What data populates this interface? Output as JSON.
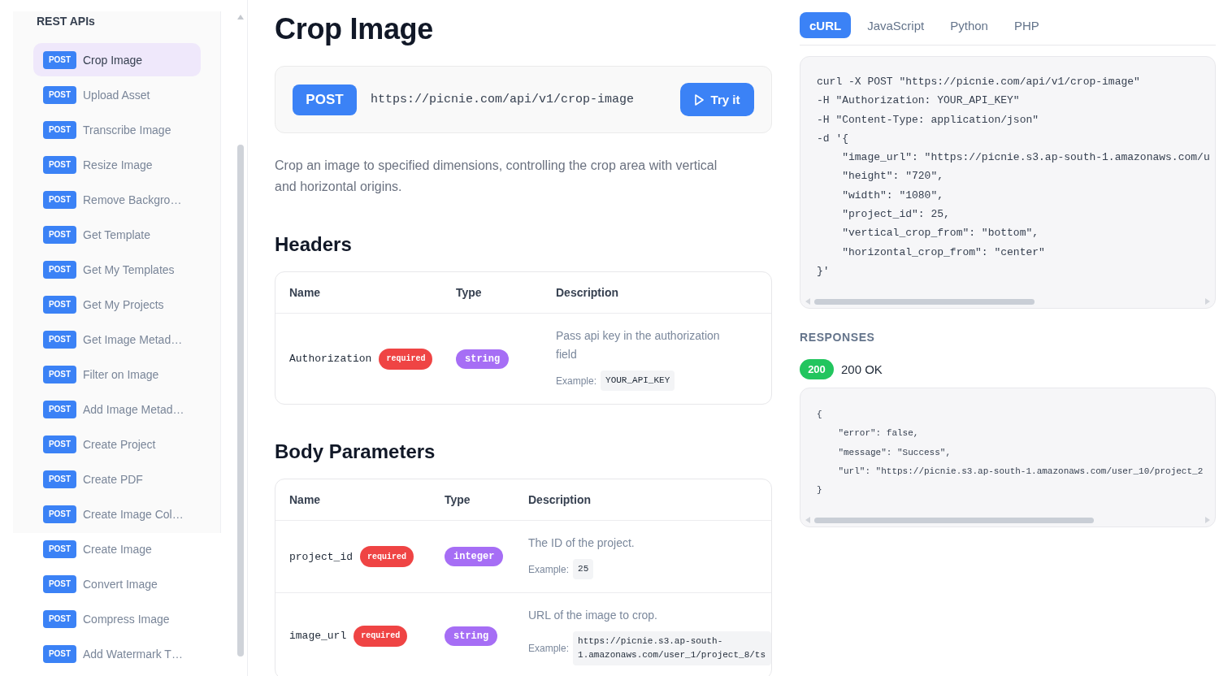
{
  "sidebar": {
    "title": "REST APIs",
    "items": [
      {
        "method": "POST",
        "label": "Crop Image",
        "selected": true
      },
      {
        "method": "POST",
        "label": "Upload Asset",
        "selected": false
      },
      {
        "method": "POST",
        "label": "Transcribe Image",
        "selected": false
      },
      {
        "method": "POST",
        "label": "Resize Image",
        "selected": false
      },
      {
        "method": "POST",
        "label": "Remove Backgro…",
        "selected": false
      },
      {
        "method": "POST",
        "label": "Get Template",
        "selected": false
      },
      {
        "method": "POST",
        "label": "Get My Templates",
        "selected": false
      },
      {
        "method": "POST",
        "label": "Get My Projects",
        "selected": false
      },
      {
        "method": "POST",
        "label": "Get Image Metad…",
        "selected": false
      },
      {
        "method": "POST",
        "label": "Filter on Image",
        "selected": false
      },
      {
        "method": "POST",
        "label": "Add Image Metad…",
        "selected": false
      },
      {
        "method": "POST",
        "label": "Create Project",
        "selected": false
      },
      {
        "method": "POST",
        "label": "Create PDF",
        "selected": false
      },
      {
        "method": "POST",
        "label": "Create Image Col…",
        "selected": false
      },
      {
        "method": "POST",
        "label": "Create Image",
        "selected": false
      },
      {
        "method": "POST",
        "label": "Convert Image",
        "selected": false
      },
      {
        "method": "POST",
        "label": "Compress Image",
        "selected": false
      },
      {
        "method": "POST",
        "label": "Add Watermark T…",
        "selected": false
      }
    ]
  },
  "page": {
    "title": "Crop Image"
  },
  "endpoint": {
    "method": "POST",
    "url": "https://picnie.com/api/v1/crop-image",
    "try_button": "Try it"
  },
  "description": "Crop an image to specified dimensions, controlling the crop area with vertical and horizontal origins.",
  "sections": [
    {
      "title": "Headers",
      "columns": [
        "Name",
        "Type",
        "Description"
      ],
      "rows": [
        {
          "name": "Authorization",
          "badge": "required",
          "type": "string",
          "description": "Pass api key in the authorization field",
          "example_label": "Example:",
          "example": "YOUR_API_KEY"
        }
      ]
    },
    {
      "title": "Body Parameters",
      "columns": [
        "Name",
        "Type",
        "Description"
      ],
      "rows": [
        {
          "name": "project_id",
          "badge": "required",
          "type": "integer",
          "description": "The ID of the project.",
          "example_label": "Example:",
          "example": "25"
        },
        {
          "name": "image_url",
          "badge": "required",
          "type": "string",
          "description": "URL of the image to crop.",
          "example_label": "Example:",
          "example": "https://picnie.s3.ap-south-1.amazonaws.com/user_1/project_8/ts"
        }
      ]
    }
  ],
  "code_tabs": [
    {
      "label": "cURL",
      "selected": true
    },
    {
      "label": "JavaScript",
      "selected": false
    },
    {
      "label": "Python",
      "selected": false
    },
    {
      "label": "PHP",
      "selected": false
    }
  ],
  "request_code": {
    "lines": [
      "curl -X POST \"https://picnie.com/api/v1/crop-image\"",
      "-H \"Authorization: YOUR_API_KEY\"",
      "-H \"Content-Type: application/json\"",
      "-d '{",
      "    \"image_url\": \"https://picnie.s3.ap-south-1.amazonaws.com/u",
      "    \"height\": \"720\",",
      "    \"width\": \"1080\",",
      "    \"project_id\": 25,",
      "    \"vertical_crop_from\": \"bottom\",",
      "    \"horizontal_crop_from\": \"center\"",
      "}'"
    ]
  },
  "responses": {
    "title": "RESPONSES",
    "status_code": "200",
    "status_text": "200 OK",
    "lines": [
      "{",
      "    \"error\": false,",
      "    \"message\": \"Success\",",
      "    \"url\": \"https://picnie.s3.ap-south-1.amazonaws.com/user_10/project_2",
      "}"
    ]
  }
}
